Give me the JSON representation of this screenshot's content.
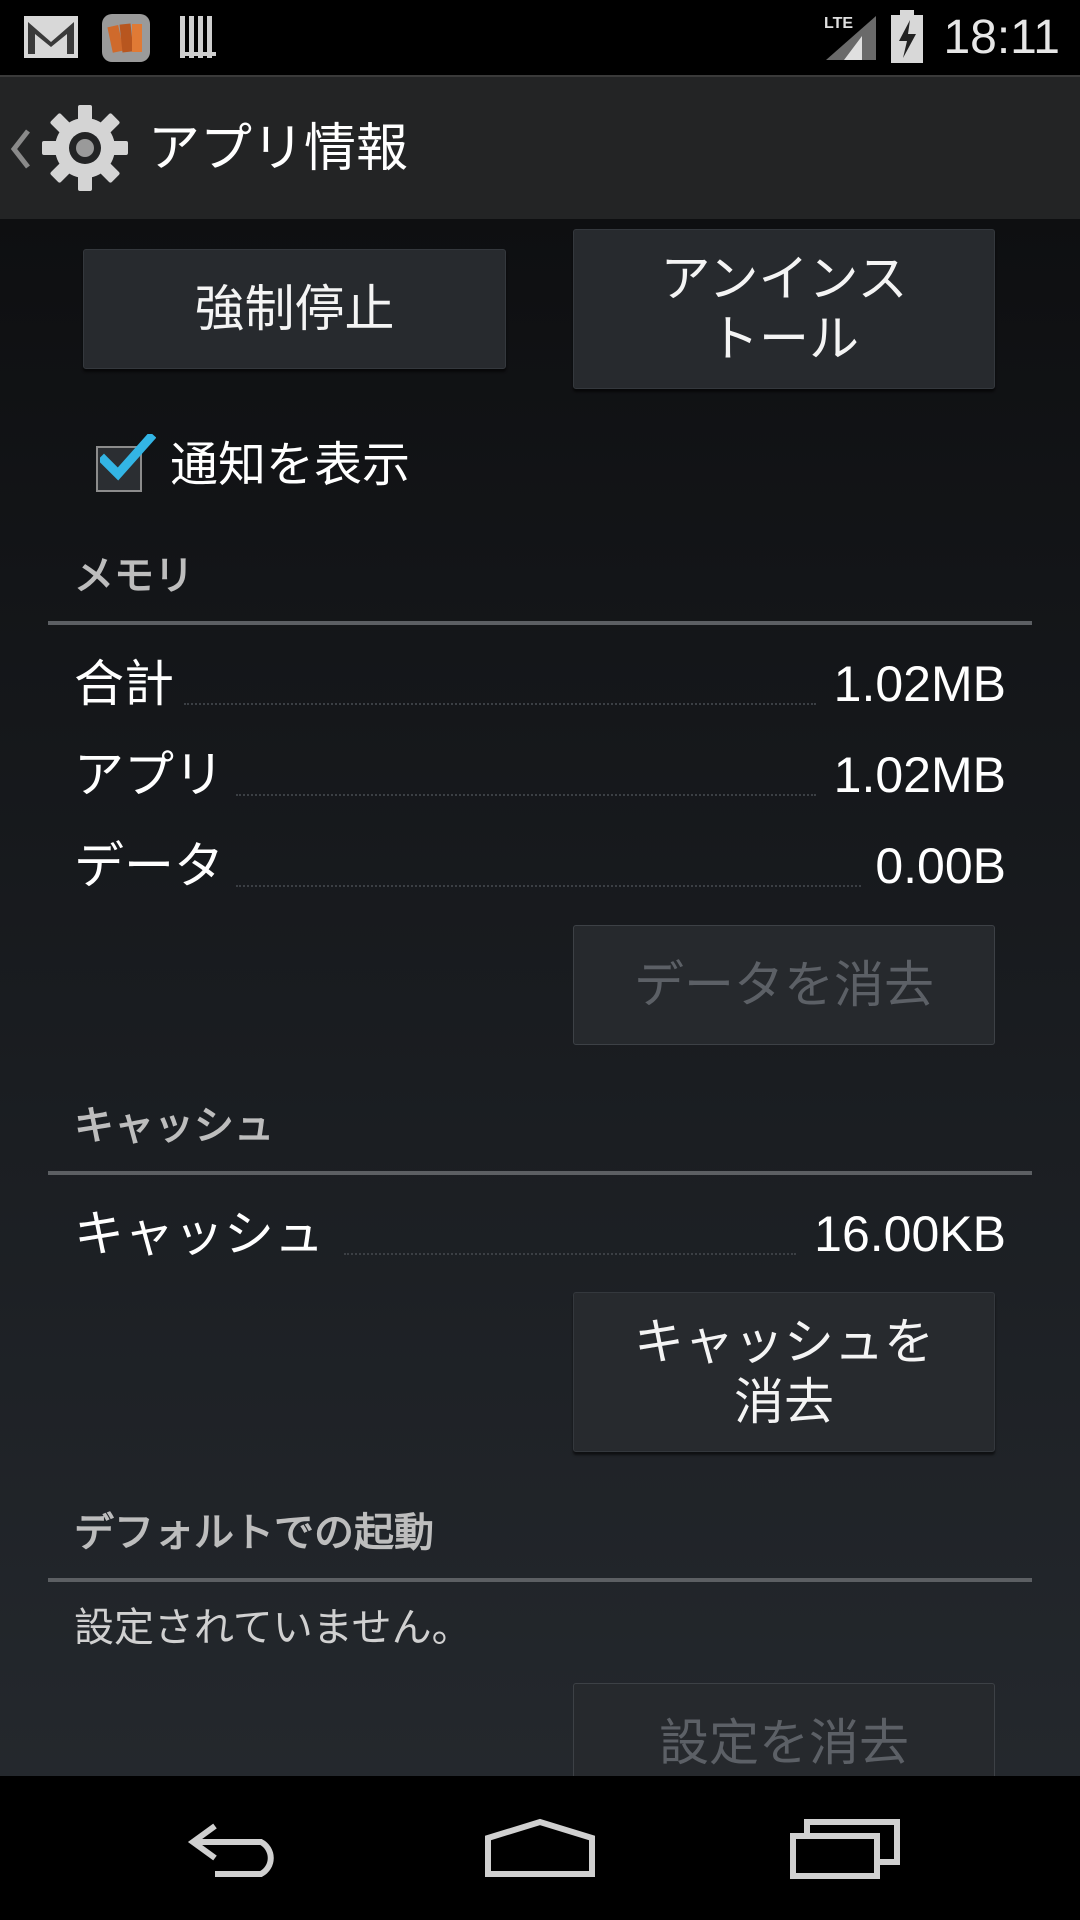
{
  "status_bar": {
    "time": "18:11",
    "network_label": "LTE",
    "icons": [
      "gmail-icon",
      "books-icon",
      "barcode-icon",
      "lte-signal-icon",
      "battery-charging-icon"
    ]
  },
  "action_bar": {
    "title": "アプリ情報",
    "icons": [
      "up-chevron-icon",
      "settings-gear-icon"
    ]
  },
  "buttons": {
    "force_stop": "強制停止",
    "uninstall": "アンインス\nトール",
    "clear_data": "データを消去",
    "clear_cache": "キャッシュを\n消去",
    "clear_defaults": "設定を消去"
  },
  "notification_checkbox": {
    "label": "通知を表示",
    "checked": true
  },
  "memory": {
    "header": "メモリ",
    "rows": [
      {
        "label": "合計",
        "value": "1.02MB"
      },
      {
        "label": "アプリ",
        "value": "1.02MB"
      },
      {
        "label": "データ",
        "value": "0.00B"
      }
    ]
  },
  "cache": {
    "header": "キャッシュ",
    "rows": [
      {
        "label": "キャッシュ",
        "value": "16.00KB"
      }
    ]
  },
  "launch_defaults": {
    "header": "デフォルトでの起動",
    "text": "設定されていません。"
  },
  "colors": {
    "accent_check": "#33b5e5",
    "actionbar_bg": "#232425",
    "disabled_text": "#5c6066"
  }
}
